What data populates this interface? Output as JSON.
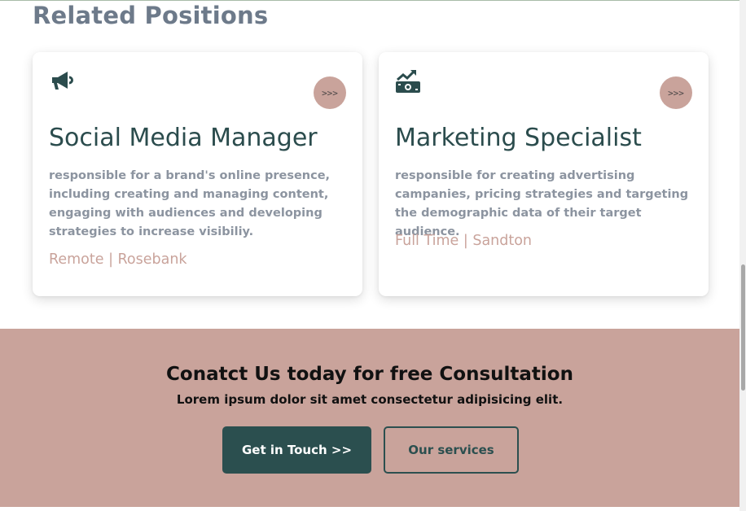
{
  "section": {
    "title": "Related Positions"
  },
  "cards": [
    {
      "icon": "megaphone-icon",
      "arrow_label": ">>>",
      "title": "Social Media Manager",
      "description": "responsible for a brand's online presence, including creating and managing content, engaging with audiences and developing strategies to increase visibiliy.",
      "meta": "Remote | Rosebank"
    },
    {
      "icon": "money-growth-icon",
      "arrow_label": ">>>",
      "title": "Marketing Specialist",
      "description": "responsible for creating advertising campanies, pricing strategies and targeting the demographic data of their target audience.",
      "meta": "Full Time | Sandton"
    }
  ],
  "contact": {
    "title": "Conatct Us today for free Consultation",
    "subtitle": "Lorem ipsum dolor sit amet consectetur adipisicing elit.",
    "primary_button": "Get in Touch >>",
    "secondary_button": "Our services"
  },
  "colors": {
    "accent": "#c9a39b",
    "dark_teal": "#2b4f4f",
    "heading_gray": "#6d7a8a",
    "body_gray": "#8c94a0"
  }
}
